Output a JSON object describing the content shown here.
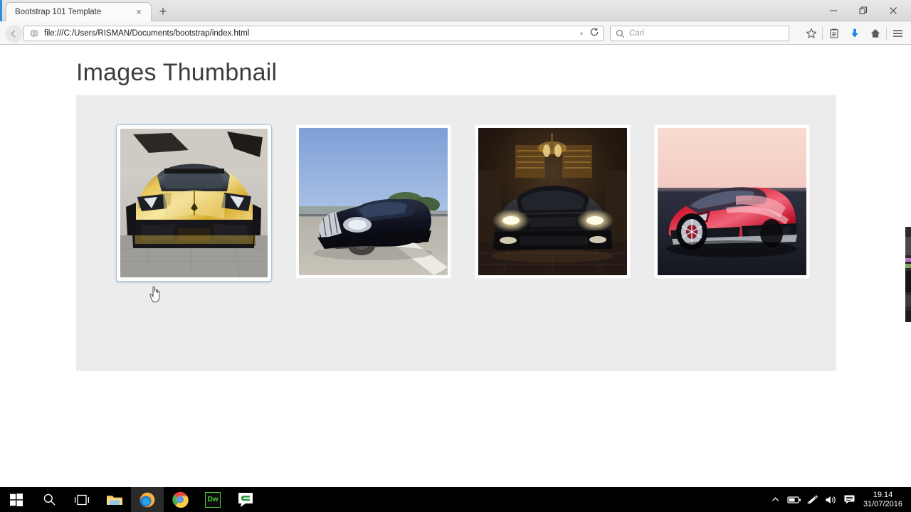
{
  "browser": {
    "tab": {
      "title": "Bootstrap 101 Template",
      "close_label": "×"
    },
    "new_tab_label": "+",
    "window_controls": {
      "minimize": "–",
      "restore": "❐",
      "close": "×"
    },
    "address": {
      "url": "file:///C:/Users/RISMAN/Documents/bootstrap/index.html",
      "dropdown_label": "▾",
      "reload_name": "reload-icon"
    },
    "search": {
      "placeholder": "Cari",
      "value": ""
    },
    "toolbar_icons": [
      "bookmark-star-icon",
      "reading-list-icon",
      "downloads-icon",
      "home-icon",
      "menu-icon"
    ],
    "accent_download_color": "#1a7ff0"
  },
  "page": {
    "heading": "Images Thumbnail",
    "panel_bg": "#ececec",
    "thumbnails": [
      {
        "alt": "Gold chrome Lamborghini Aventador front view",
        "state": "active",
        "border_color": "#a9c6dd"
      },
      {
        "alt": "Dark blue Maybach Exelero on highway",
        "state": "normal",
        "border_color": "#f2f2f2"
      },
      {
        "alt": "Black Chrysler sedan in lit showroom",
        "state": "normal",
        "border_color": "#f2f2f2"
      },
      {
        "alt": "Red sports car concept at dusk",
        "state": "normal",
        "border_color": "#f2f2f2"
      }
    ]
  },
  "taskbar": {
    "items": [
      {
        "name": "start-button",
        "label": "Windows"
      },
      {
        "name": "search-button",
        "label": "Search"
      },
      {
        "name": "task-view-button",
        "label": "Task View"
      },
      {
        "name": "file-explorer-button",
        "label": "File Explorer"
      },
      {
        "name": "firefox-button",
        "label": "Firefox",
        "active": true
      },
      {
        "name": "chrome-button",
        "label": "Google Chrome"
      },
      {
        "name": "dreamweaver-button",
        "label": "Dw"
      },
      {
        "name": "codelobster-button",
        "label": "C"
      }
    ],
    "tray_icons": [
      "show-hidden-icons",
      "battery-icon",
      "wifi-icon",
      "volume-icon",
      "action-center-icon"
    ],
    "clock": {
      "time": "19.14",
      "date": "31/07/2016"
    }
  }
}
